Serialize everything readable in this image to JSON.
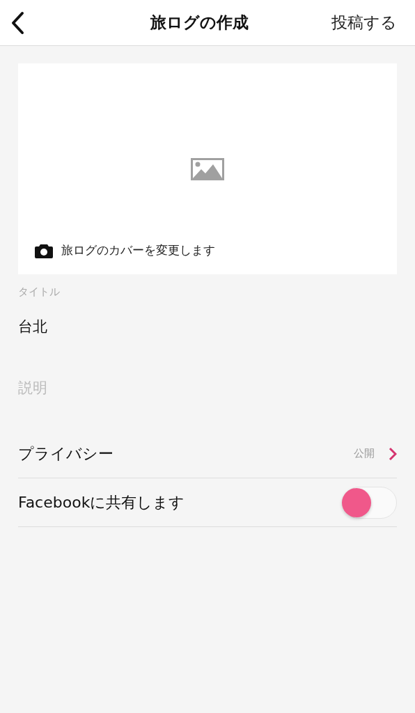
{
  "header": {
    "title": "旅ログの作成",
    "action": "投稿する"
  },
  "cover": {
    "caption": "旅ログのカバーを変更します"
  },
  "title_field": {
    "label": "タイトル",
    "value": "台北"
  },
  "description_field": {
    "placeholder": "説明"
  },
  "settings": [
    {
      "kind": "link",
      "label": "プライバシー",
      "value": "公開"
    },
    {
      "kind": "toggle",
      "label": "Facebookに共有します",
      "on": false
    }
  ]
}
